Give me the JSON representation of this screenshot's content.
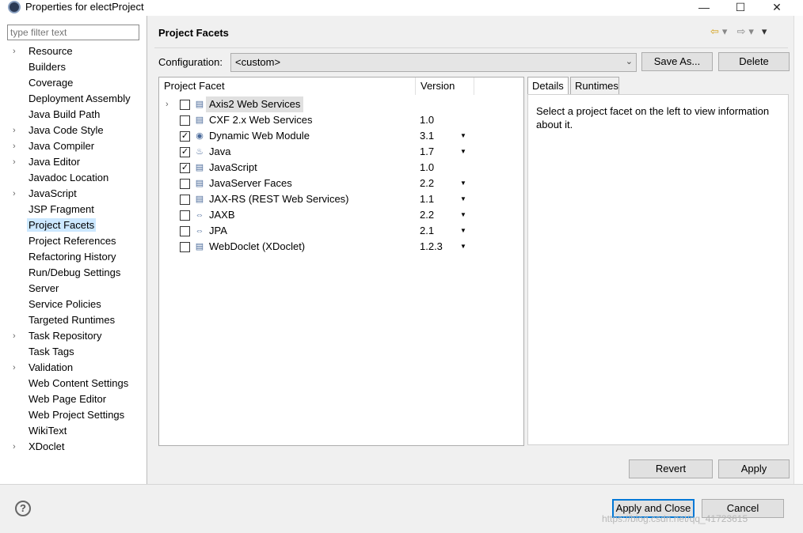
{
  "window": {
    "title": "Properties for electProject",
    "minimize": "—",
    "maximize": "☐",
    "close": "✕"
  },
  "filter": {
    "placeholder": "type filter text"
  },
  "sidebar": {
    "items": [
      {
        "label": "Resource",
        "expandable": true
      },
      {
        "label": "Builders",
        "expandable": false
      },
      {
        "label": "Coverage",
        "expandable": false
      },
      {
        "label": "Deployment Assembly",
        "expandable": false
      },
      {
        "label": "Java Build Path",
        "expandable": false
      },
      {
        "label": "Java Code Style",
        "expandable": true
      },
      {
        "label": "Java Compiler",
        "expandable": true
      },
      {
        "label": "Java Editor",
        "expandable": true
      },
      {
        "label": "Javadoc Location",
        "expandable": false
      },
      {
        "label": "JavaScript",
        "expandable": true
      },
      {
        "label": "JSP Fragment",
        "expandable": false
      },
      {
        "label": "Project Facets",
        "expandable": false,
        "selected": true
      },
      {
        "label": "Project References",
        "expandable": false
      },
      {
        "label": "Refactoring History",
        "expandable": false
      },
      {
        "label": "Run/Debug Settings",
        "expandable": false
      },
      {
        "label": "Server",
        "expandable": false
      },
      {
        "label": "Service Policies",
        "expandable": false
      },
      {
        "label": "Targeted Runtimes",
        "expandable": false
      },
      {
        "label": "Task Repository",
        "expandable": true
      },
      {
        "label": "Task Tags",
        "expandable": false
      },
      {
        "label": "Validation",
        "expandable": true
      },
      {
        "label": "Web Content Settings",
        "expandable": false
      },
      {
        "label": "Web Page Editor",
        "expandable": false
      },
      {
        "label": "Web Project Settings",
        "expandable": false
      },
      {
        "label": "WikiText",
        "expandable": false
      },
      {
        "label": "XDoclet",
        "expandable": true
      }
    ]
  },
  "page": {
    "title": "Project Facets",
    "nav": {
      "back": "⇦",
      "back_menu": "▾",
      "forward": "⇨",
      "forward_menu": "▾",
      "view_menu": "▾"
    }
  },
  "configuration": {
    "label": "Configuration:",
    "value": "<custom>",
    "save_as": "Save As...",
    "delete": "Delete"
  },
  "facets": {
    "col_facet": "Project Facet",
    "col_version": "Version",
    "rows": [
      {
        "name": "Axis2 Web Services",
        "version": "",
        "checked": false,
        "expandable": true,
        "dropdown": false,
        "icon": "page-icon"
      },
      {
        "name": "CXF 2.x Web Services",
        "version": "1.0",
        "checked": false,
        "expandable": false,
        "dropdown": false,
        "icon": "page-icon"
      },
      {
        "name": "Dynamic Web Module",
        "version": "3.1",
        "checked": true,
        "expandable": false,
        "dropdown": true,
        "icon": "globe-icon"
      },
      {
        "name": "Java",
        "version": "1.7",
        "checked": true,
        "expandable": false,
        "dropdown": true,
        "icon": "java-icon"
      },
      {
        "name": "JavaScript",
        "version": "1.0",
        "checked": true,
        "expandable": false,
        "dropdown": false,
        "icon": "page-icon"
      },
      {
        "name": "JavaServer Faces",
        "version": "2.2",
        "checked": false,
        "expandable": false,
        "dropdown": true,
        "icon": "page-icon"
      },
      {
        "name": "JAX-RS (REST Web Services)",
        "version": "1.1",
        "checked": false,
        "expandable": false,
        "dropdown": true,
        "icon": "page-icon"
      },
      {
        "name": "JAXB",
        "version": "2.2",
        "checked": false,
        "expandable": false,
        "dropdown": true,
        "icon": "arrows-icon"
      },
      {
        "name": "JPA",
        "version": "2.1",
        "checked": false,
        "expandable": false,
        "dropdown": true,
        "icon": "arrows-icon"
      },
      {
        "name": "WebDoclet (XDoclet)",
        "version": "1.2.3",
        "checked": false,
        "expandable": false,
        "dropdown": true,
        "icon": "page-icon"
      }
    ]
  },
  "details": {
    "tab_details": "Details",
    "tab_runtimes": "Runtimes",
    "message": "Select a project facet on the left to view information about it."
  },
  "buttons": {
    "revert": "Revert",
    "apply": "Apply",
    "apply_close": "Apply and Close",
    "cancel": "Cancel"
  },
  "help": "?",
  "watermark": "https://blog.csdn.net/qq_41723615"
}
